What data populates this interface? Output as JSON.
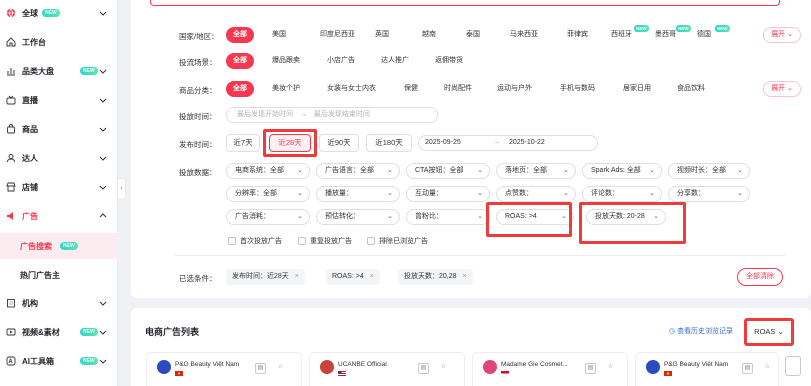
{
  "colors": {
    "accent": "#f5384f",
    "new_badge": "#3dd9c0",
    "highlight_box": "#ef3b3b",
    "link": "#3b6fd8"
  },
  "sidebar": {
    "items": [
      {
        "label": "全球",
        "icon": "globe-icon",
        "badge": "NEW"
      },
      {
        "label": "工作台",
        "icon": "home-icon"
      },
      {
        "label": "品类大盘",
        "icon": "chart-icon",
        "badge": "NEW"
      },
      {
        "label": "直播",
        "icon": "live-icon"
      },
      {
        "label": "商品",
        "icon": "bag-icon"
      },
      {
        "label": "达人",
        "icon": "user-icon"
      },
      {
        "label": "店铺",
        "icon": "store-icon"
      },
      {
        "label": "广告",
        "icon": "ad-icon"
      },
      {
        "label": "机构",
        "icon": "org-icon"
      },
      {
        "label": "视频&素材",
        "icon": "video-icon",
        "badge": "NEW"
      },
      {
        "label": "AI工具箱",
        "icon": "ai-icon",
        "badge": "NEW"
      }
    ],
    "sub_items": [
      {
        "label": "广告搜索",
        "badge": "NEW"
      },
      {
        "label": "热门广告主"
      }
    ]
  },
  "filters": {
    "region": {
      "label": "国家/地区：",
      "options": [
        "全部",
        "美国",
        "印度尼西亚",
        "英国",
        "越南",
        "泰国",
        "马来西亚",
        "菲律宾",
        "西班牙",
        "墨西哥",
        "德国"
      ],
      "new_on": [
        "西班牙",
        "墨西哥",
        "德国"
      ],
      "expand": "展开"
    },
    "scene": {
      "label": "投流场景：",
      "options": [
        "全部",
        "爆品跟卖",
        "小店广告",
        "达人推广",
        "返佣带货"
      ]
    },
    "category": {
      "label": "商品分类：",
      "options": [
        "全部",
        "美妆个护",
        "女装与女士内衣",
        "保健",
        "时尚配件",
        "运动与户外",
        "手机与数码",
        "居家日用",
        "食品饮料"
      ],
      "expand": "展开"
    },
    "launch_time": {
      "label": "投放时间：",
      "start_placeholder": "最后发现开始时间",
      "end_placeholder": "最后发现结束时间",
      "arrow": "→"
    },
    "publish_time": {
      "label": "发布时间：",
      "options": [
        "近7天",
        "近28天",
        "近90天",
        "近180天"
      ],
      "selected": "近28天",
      "start_date": "2025-09-25",
      "end_date": "2025-10-22",
      "arrow": "→"
    },
    "advanced": {
      "label": "投放数据：",
      "row1": [
        "电商系统：全部",
        "广告语言：全部",
        "CTA按钮：全部",
        "落地页：全部",
        "Spark Ads: 全部",
        "视频时长：全部"
      ],
      "row2": [
        "分辨率：全部",
        "播放量：",
        "互动量：",
        "点赞数：",
        "评论数：",
        "分享数："
      ],
      "row3": [
        "广告消耗：",
        "预估转化：",
        "曾粉比：",
        "ROAS:  >4",
        "投放天数:  20-28"
      ]
    },
    "checkboxes": [
      "首次投放广告",
      "重复投放广告",
      "排除已浏览广告"
    ],
    "conditions": {
      "label": "已选条件：",
      "tags": [
        "发布时间：近28天",
        "ROAS:  >4",
        "投放天数：20,28"
      ],
      "clear": "全部清除"
    }
  },
  "list": {
    "title": "电商广告列表",
    "history_link": "查看历史浏览记录",
    "sort_button": "ROAS",
    "cards": [
      {
        "name": "P&G Beauty Việt Nam",
        "flag": "vietnam-flag"
      },
      {
        "name": "UCANBE Official",
        "flag": "us-flag"
      },
      {
        "name": "Madame Gie Cosmet...",
        "flag": "indonesia-flag"
      },
      {
        "name": "P&G Beauty Việt Nam",
        "flag": "vietnam-flag"
      }
    ]
  }
}
